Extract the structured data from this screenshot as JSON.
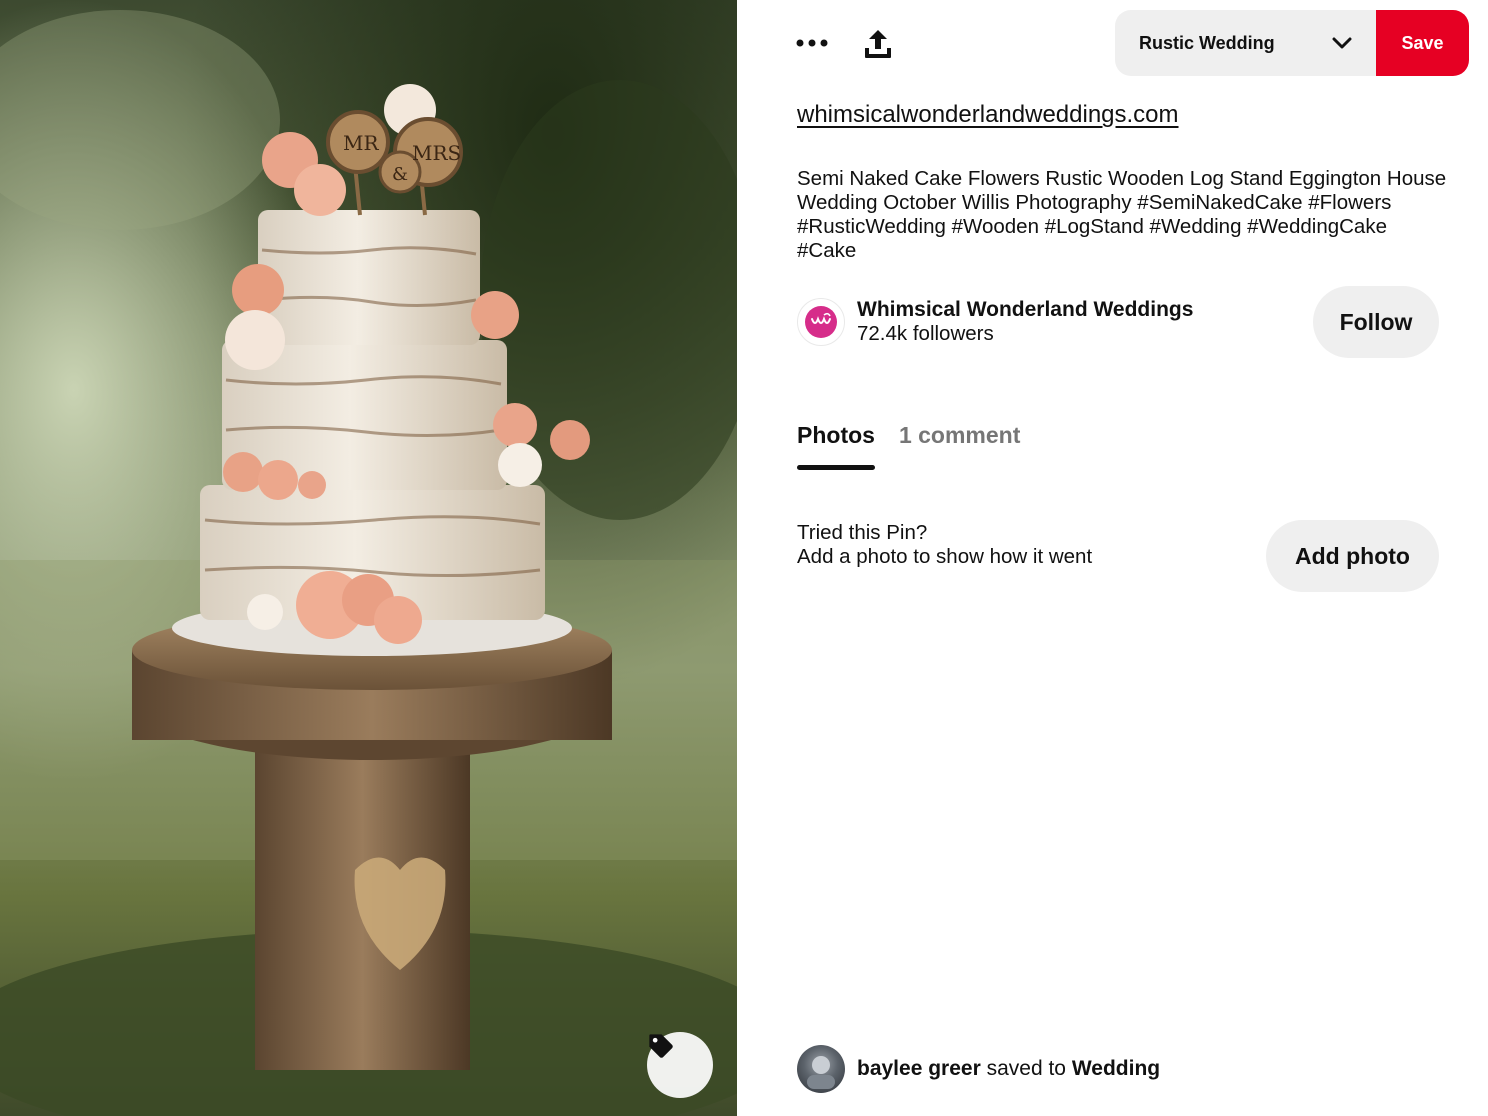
{
  "toolbar": {
    "more_icon": "ellipsis-icon",
    "share_icon": "share-upload-icon",
    "board_select_value": "Rustic Wedding",
    "save_label": "Save",
    "save_color": "#e60023"
  },
  "pin": {
    "source_link": "whimsicalwonderlandweddings.com",
    "description": "Semi Naked Cake Flowers Rustic Wooden Log Stand Eggington House Wedding October Willis Photography #SemiNakedCake #Flowers #RusticWedding #Wooden #LogStand #Wedding #WeddingCake #Cake",
    "image_tag_icon": "tag-icon",
    "topper_text_left": "MR",
    "topper_text_mid": "&",
    "topper_text_right": "MRS"
  },
  "creator": {
    "name": "Whimsical Wonderland Weddings",
    "followers": "72.4k followers",
    "follow_label": "Follow"
  },
  "tabs": [
    {
      "label": "Photos",
      "active": true
    },
    {
      "label": "1 comment",
      "active": false
    }
  ],
  "tried": {
    "line1": "Tried this Pin?",
    "line2": "Add a photo to show how it went",
    "add_photo_label": "Add photo"
  },
  "saved_by": {
    "user": "baylee greer",
    "verb": "saved to",
    "board": "Wedding"
  }
}
